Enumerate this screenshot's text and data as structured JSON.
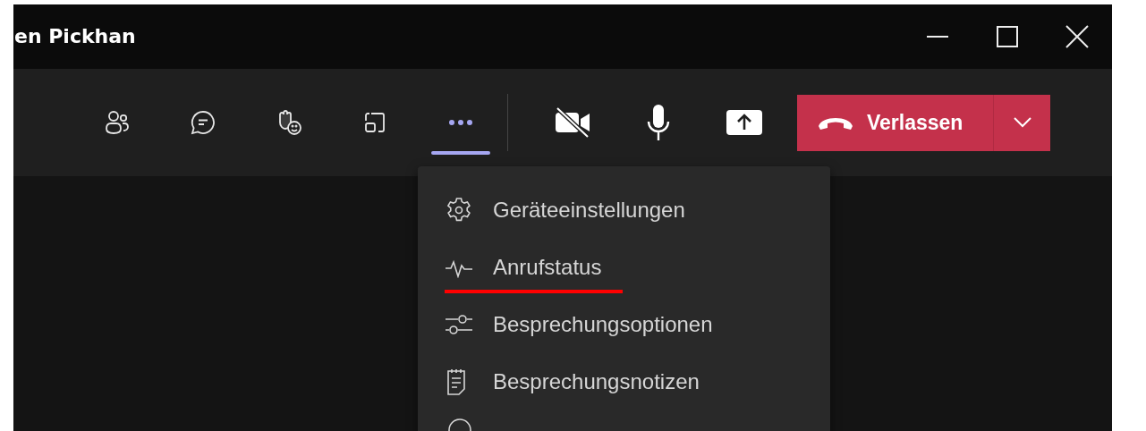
{
  "window": {
    "title": "en Pickhan"
  },
  "toolbar": {
    "items": [
      {
        "kind": "people",
        "selected": false
      },
      {
        "kind": "chat",
        "selected": false
      },
      {
        "kind": "react",
        "selected": false
      },
      {
        "kind": "rooms",
        "selected": false
      },
      {
        "kind": "more",
        "selected": true
      }
    ],
    "camera": {
      "on": false
    },
    "leave_button": {
      "label": "Verlassen"
    }
  },
  "menu": {
    "items": [
      {
        "kind": "gear",
        "label": "Geräteeinstellungen",
        "underlined": false
      },
      {
        "kind": "pulse",
        "label": "Anrufstatus",
        "underlined": true
      },
      {
        "kind": "sliders",
        "label": "Besprechungsoptionen",
        "underlined": false
      },
      {
        "kind": "notes",
        "label": "Besprechungsnotizen",
        "underlined": false
      }
    ]
  }
}
